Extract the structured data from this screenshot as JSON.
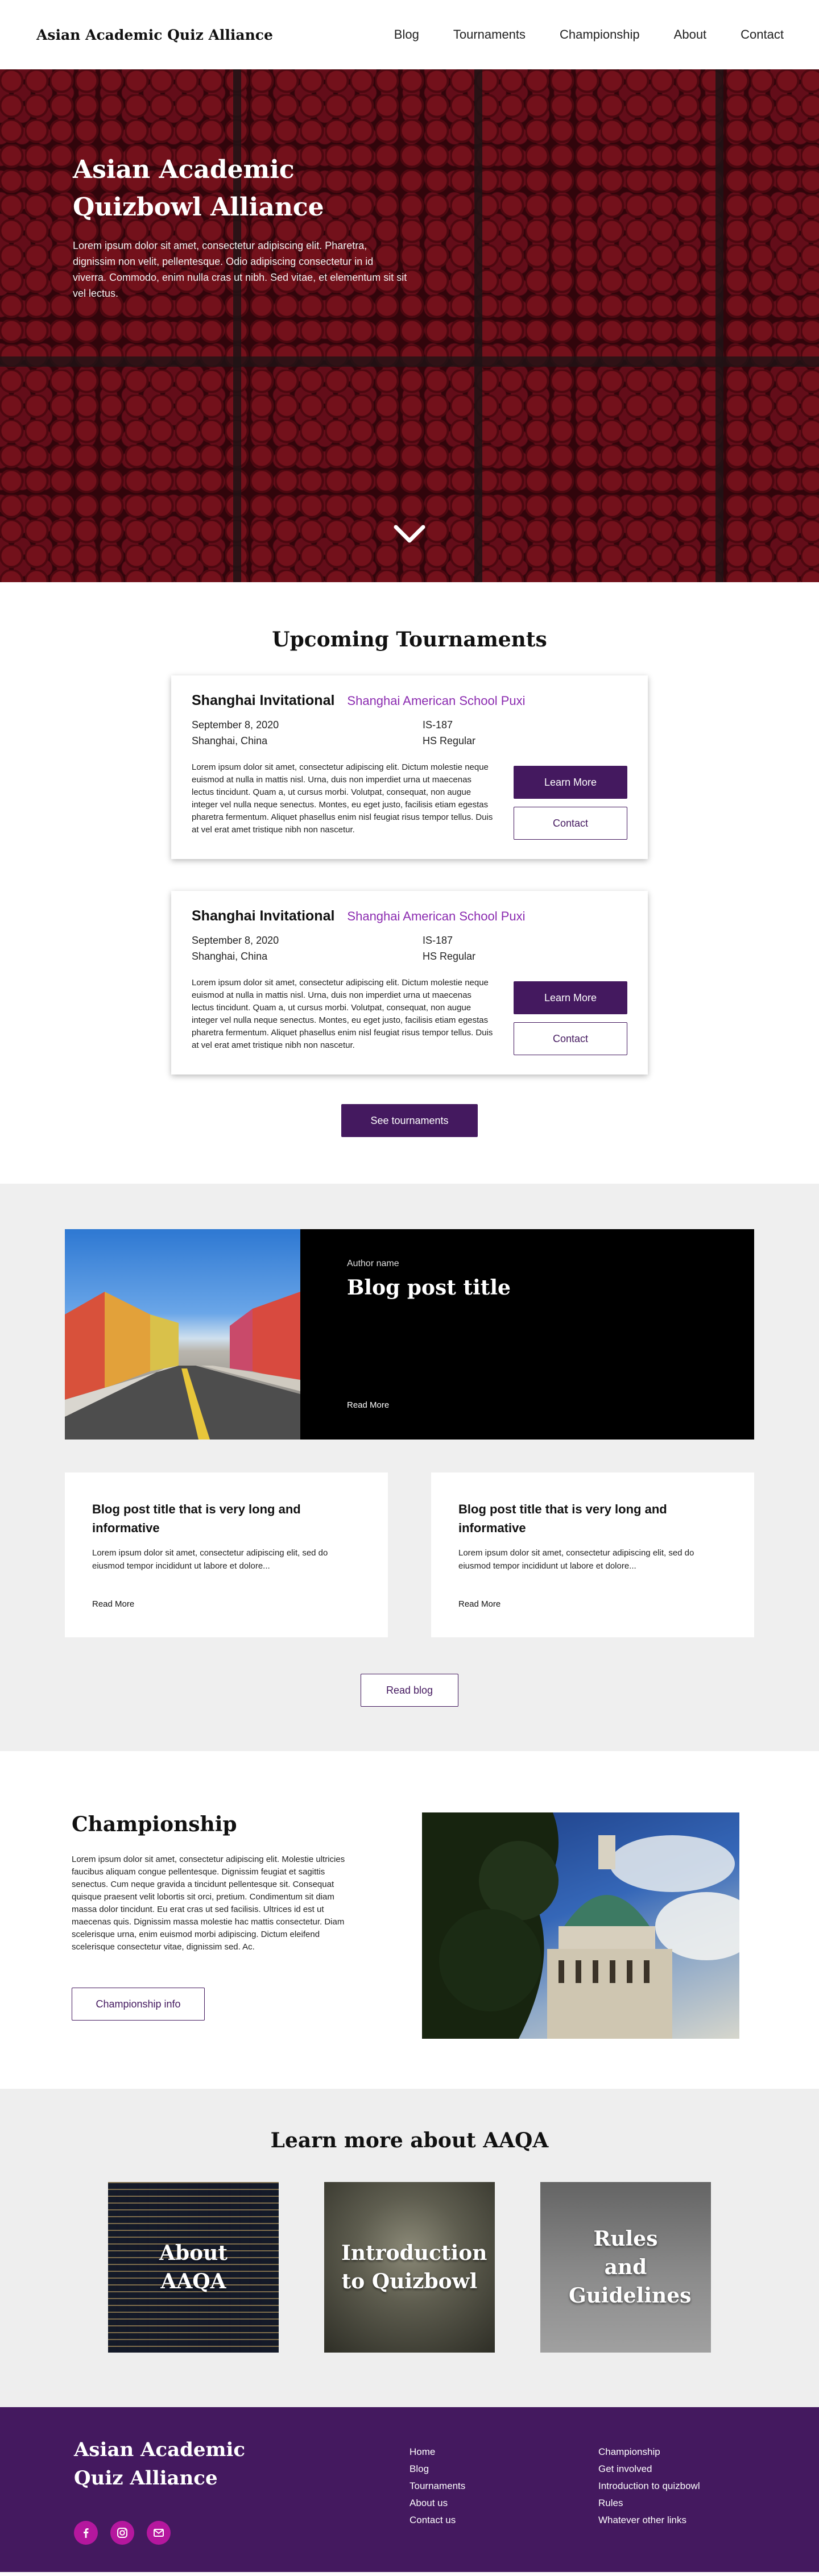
{
  "nav": {
    "brand": "Asian Academic Quiz Alliance",
    "links": [
      "Blog",
      "Tournaments",
      "Championship",
      "About",
      "Contact"
    ]
  },
  "hero": {
    "title": "Asian Academic Quizbowl Alliance",
    "text": "Lorem ipsum dolor sit amet, consectetur adipiscing elit. Pharetra, dignissim non velit, pellentesque. Odio adipiscing consectetur in id viverra. Commodo, enim nulla cras ut nibh. Sed vitae, et elementum sit sit vel lectus.",
    "chevron_icon": "chevron-down-icon"
  },
  "tournaments": {
    "title": "Upcoming Tournaments",
    "cards": [
      {
        "name": "Shanghai Invitational",
        "school": "Shanghai American School Puxi",
        "date": "September 8, 2020",
        "code": "IS-187",
        "location": "Shanghai, China",
        "level": "HS Regular",
        "description": "Lorem ipsum dolor sit amet, consectetur adipiscing elit. Dictum molestie neque euismod at nulla in mattis nisl. Urna, duis non imperdiet urna ut maecenas lectus tincidunt. Quam a, ut cursus morbi. Volutpat, consequat, non augue integer vel nulla neque senectus. Montes, eu eget justo, facilisis etiam egestas pharetra fermentum. Aliquet phasellus enim nisl feugiat risus tempor tellus. Duis at vel erat amet tristique nibh non nascetur.",
        "learn_label": "Learn More",
        "contact_label": "Contact"
      },
      {
        "name": "Shanghai Invitational",
        "school": "Shanghai American School Puxi",
        "date": "September 8, 2020",
        "code": "IS-187",
        "location": "Shanghai, China",
        "level": "HS Regular",
        "description": "Lorem ipsum dolor sit amet, consectetur adipiscing elit. Dictum molestie neque euismod at nulla in mattis nisl. Urna, duis non imperdiet urna ut maecenas lectus tincidunt. Quam a, ut cursus morbi. Volutpat, consequat, non augue integer vel nulla neque senectus. Montes, eu eget justo, facilisis etiam egestas pharetra fermentum. Aliquet phasellus enim nisl feugiat risus tempor tellus. Duis at vel erat amet tristique nibh non nascetur.",
        "learn_label": "Learn More",
        "contact_label": "Contact"
      }
    ],
    "see_label": "See tournaments"
  },
  "blog": {
    "feature": {
      "author": "Author name",
      "title": "Blog post title",
      "read_more": "Read More"
    },
    "cards": [
      {
        "title": "Blog post title that is very long and informative",
        "text": "Lorem ipsum dolor sit amet, consectetur adipiscing elit, sed do eiusmod tempor incididunt ut labore et dolore...",
        "read_more": "Read More"
      },
      {
        "title": "Blog post title that is very long and informative",
        "text": "Lorem ipsum dolor sit amet, consectetur adipiscing elit, sed do eiusmod tempor incididunt ut labore et dolore...",
        "read_more": "Read More"
      }
    ],
    "read_blog_label": "Read blog"
  },
  "championship": {
    "title": "Championship",
    "text": "Lorem ipsum dolor sit amet, consectetur adipiscing elit. Molestie ultricies faucibus aliquam congue pellentesque. Dignissim feugiat et sagittis senectus. Cum neque gravida a tincidunt pellentesque sit. Consequat quisque praesent velit lobortis sit orci, pretium. Condimentum sit diam massa dolor tincidunt. Eu erat cras ut sed facilisis. Ultrices id est ut maecenas quis. Dignissim massa molestie hac mattis consectetur. Diam scelerisque urna, enim euismod morbi adipiscing. Dictum eleifend scelerisque consectetur vitae, dignissim sed. Ac.",
    "button_label": "Championship info"
  },
  "learn": {
    "title": "Learn more about AAQA",
    "cards": [
      "About AAQA",
      "Introduction to Quizbowl",
      "Rules and Guidelines"
    ]
  },
  "footer": {
    "brand": "Asian Academic Quiz Alliance",
    "social_icons": [
      "facebook-icon",
      "instagram-icon",
      "mail-icon"
    ],
    "col1": [
      "Home",
      "Blog",
      "Tournaments",
      "About us",
      "Contact us"
    ],
    "col2": [
      "Championship",
      "Get involved",
      "Introduction to quizbowl",
      "Rules",
      "Whatever other links"
    ]
  },
  "colors": {
    "primary": "#44195f",
    "accent_purple": "#8b2bb0",
    "social_pink": "#b5179e",
    "section_gray": "#efefef"
  }
}
